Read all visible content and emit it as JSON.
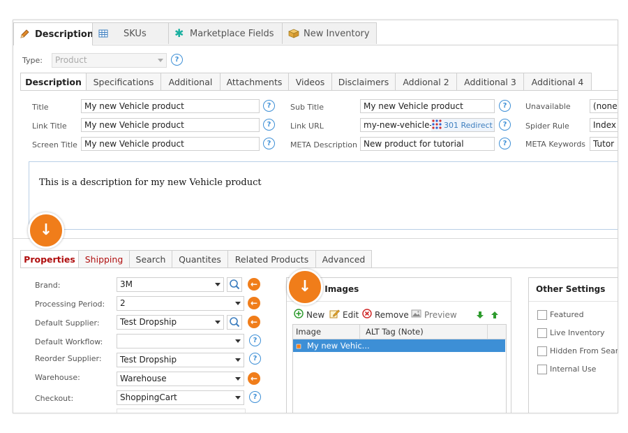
{
  "top_tabs": [
    {
      "label": "Description",
      "icon": "pencil-icon"
    },
    {
      "label": "SKUs",
      "icon": "grid-icon"
    },
    {
      "label": "Marketplace Fields",
      "icon": "asterisk-icon"
    },
    {
      "label": "New Inventory",
      "icon": "box-icon"
    }
  ],
  "type_field": {
    "label": "Type:",
    "value": "Product"
  },
  "desc_tabs": [
    "Description",
    "Specifications",
    "Additional",
    "Attachments",
    "Videos",
    "Disclaimers",
    "Addional 2",
    "Additional 3",
    "Additional 4"
  ],
  "fields": {
    "title": {
      "label": "Title",
      "value": "My new Vehicle product"
    },
    "link_title": {
      "label": "Link Title",
      "value": "My new Vehicle product"
    },
    "screen_title": {
      "label": "Screen Title",
      "value": "My new Vehicle product"
    },
    "sub_title": {
      "label": "Sub Title",
      "value": "My new Vehicle product"
    },
    "link_url": {
      "label": "Link URL",
      "value": "my-new-vehicle-",
      "redirect": "301 Redirect"
    },
    "meta_description": {
      "label": "META Description",
      "value": "New product for tutorial"
    },
    "unavailable": {
      "label": "Unavailable",
      "value": "(none"
    },
    "spider_rule": {
      "label": "Spider Rule",
      "value": "Index"
    },
    "meta_keywords": {
      "label": "META Keywords",
      "value": "Tutor"
    }
  },
  "description_text": "This is a description for my new Vehicle product",
  "prop_tabs": [
    "Properties",
    "Shipping",
    "Search",
    "Quantites",
    "Related Products",
    "Advanced"
  ],
  "properties": [
    {
      "label": "Brand:",
      "value": "3M"
    },
    {
      "label": "Processing Period:",
      "value": "2"
    },
    {
      "label": "Default Supplier:",
      "value": "Test Dropship"
    },
    {
      "label": "Default Workflow:",
      "value": ""
    },
    {
      "label": "Reorder Supplier:",
      "value": "Test Dropship"
    },
    {
      "label": "Warehouse:",
      "value": "Warehouse"
    },
    {
      "label": "Checkout:",
      "value": "ShoppingCart"
    }
  ],
  "images_panel": {
    "title": "l Images",
    "toolbar": {
      "new": "New",
      "edit": "Edit",
      "remove": "Remove",
      "preview": "Preview"
    },
    "columns": [
      "Image",
      "ALT Tag (Note)"
    ],
    "rows": [
      {
        "image": "My new Vehic..."
      }
    ]
  },
  "other_settings": {
    "title": "Other Settings",
    "items": [
      "Featured",
      "Live Inventory",
      "Hidden From Searc",
      "Internal Use"
    ]
  },
  "colors": {
    "accent_orange": "#f07d1a",
    "selection_blue": "#3d8fd6",
    "active_red": "#b01010"
  }
}
